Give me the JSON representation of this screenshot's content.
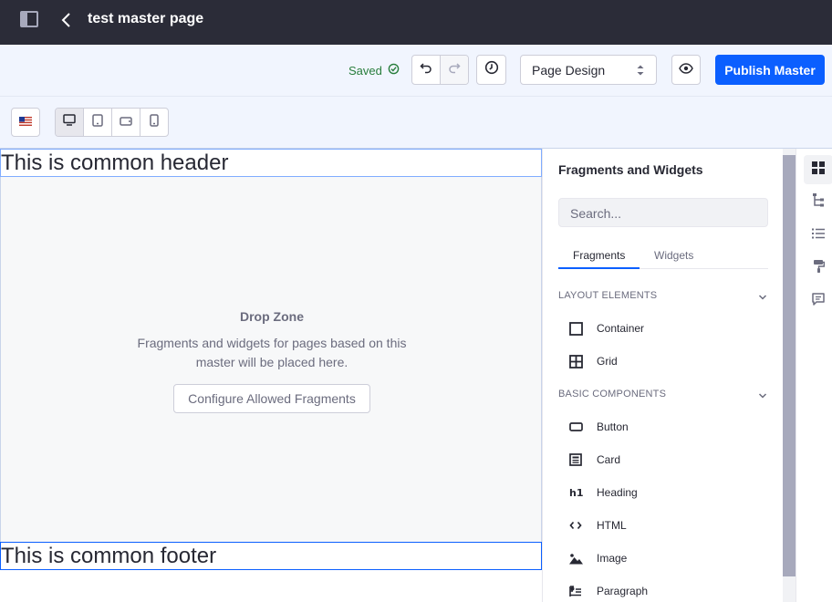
{
  "app": {
    "title": "test master page"
  },
  "toolbar": {
    "saved_label": "Saved",
    "experience_select_value": "Page Design",
    "publish_label": "Publish Master"
  },
  "canvas": {
    "header_text": "This is common header",
    "footer_text": "This is common footer",
    "dropzone": {
      "title": "Drop Zone",
      "description": "Fragments and widgets for pages based on this master will be placed here.",
      "button_label": "Configure Allowed Fragments"
    }
  },
  "panel": {
    "title": "Fragments and Widgets",
    "search_placeholder": "Search...",
    "tabs": [
      {
        "label": "Fragments",
        "active": true
      },
      {
        "label": "Widgets",
        "active": false
      }
    ],
    "sections": [
      {
        "label": "LAYOUT ELEMENTS",
        "items": [
          {
            "label": "Container",
            "icon": "container-icon"
          },
          {
            "label": "Grid",
            "icon": "grid-icon"
          }
        ]
      },
      {
        "label": "BASIC COMPONENTS",
        "items": [
          {
            "label": "Button",
            "icon": "button-icon"
          },
          {
            "label": "Card",
            "icon": "card-icon"
          },
          {
            "label": "Heading",
            "icon": "heading-icon"
          },
          {
            "label": "HTML",
            "icon": "code-icon"
          },
          {
            "label": "Image",
            "icon": "image-icon"
          },
          {
            "label": "Paragraph",
            "icon": "paragraph-icon"
          }
        ]
      }
    ]
  },
  "colors": {
    "primary": "#0b5fff",
    "topbar": "#2b2c38",
    "toolbar_bg": "#f1f5fe",
    "saved_green": "#287d3c"
  }
}
